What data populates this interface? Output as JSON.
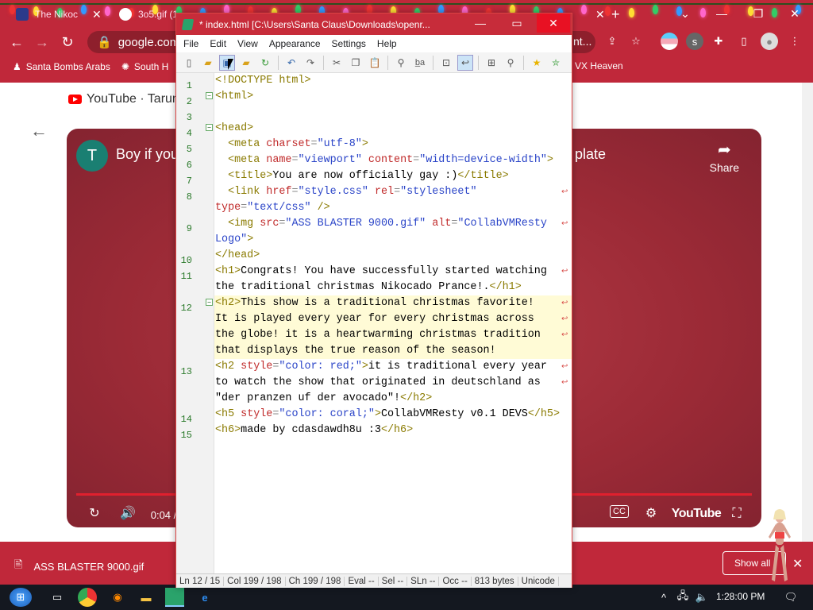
{
  "browser": {
    "tabs": [
      {
        "title": "The Nikoc"
      },
      {
        "title": "3o5.gif (1"
      }
    ],
    "address": "google.com/",
    "truncated_right": "nt...",
    "bookmarks": [
      {
        "label": "Santa Bombs Arabs"
      },
      {
        "label": "South H"
      },
      {
        "label": "VX Heaven"
      }
    ]
  },
  "page": {
    "source": "YouTube · Tarun",
    "video": {
      "channel_initial": "T",
      "title_left": "Boy if you",
      "title_right": "plate",
      "share_label": "Share",
      "time": "0:04 /",
      "brand": "YouTube",
      "progress": 0.0
    }
  },
  "download": {
    "filename": "ASS BLASTER 9000.gif",
    "show_all": "Show all"
  },
  "taskbar": {
    "clock": "1:28:00 PM"
  },
  "notepad": {
    "title": "* index.html [C:\\Users\\Santa Claus\\Downloads\\openr...",
    "menu": [
      "File",
      "Edit",
      "View",
      "Appearance",
      "Settings",
      "Help"
    ],
    "status": {
      "ln": "Ln  12 / 15",
      "col": "Col  199 / 198",
      "ch": "Ch  199 / 198",
      "eval": "Eval  --",
      "sel": "Sel  --",
      "sln": "SLn  --",
      "occ": "Occ  --",
      "size": "813 bytes",
      "enc": "Unicode"
    },
    "line_numbers": [
      "1",
      "2",
      "3",
      "4",
      "5",
      "6",
      "7",
      "8",
      "",
      "9",
      "",
      "10",
      "11",
      "",
      "12",
      "",
      "",
      "",
      "13",
      "",
      "",
      "14",
      "15"
    ]
  },
  "colors": {
    "chrome_theme": "#c0283a",
    "notepad_title": "#c72c3a",
    "highlight_line": "#fffbd6",
    "tag": "#8a7a00",
    "attr": "#c02a2a",
    "value": "#2a44c8"
  }
}
